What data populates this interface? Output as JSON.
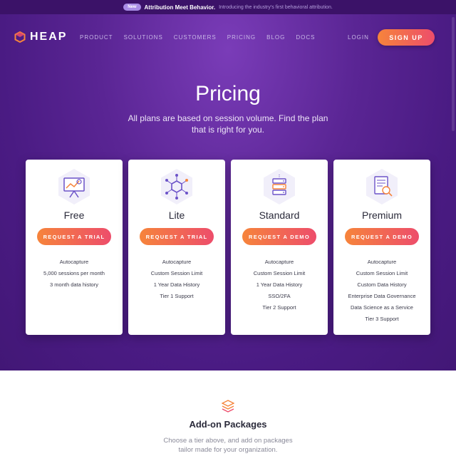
{
  "announcement": {
    "badge": "New",
    "headline": "Attribution Meet Behavior.",
    "sub": "Introducing the industry's first behavioral attribution."
  },
  "nav": {
    "logo_text": "HEAP",
    "links": [
      "PRODUCT",
      "SOLUTIONS",
      "CUSTOMERS",
      "PRICING",
      "BLOG",
      "DOCS"
    ],
    "login": "LOGIN",
    "signup": "SIGN UP"
  },
  "hero": {
    "title": "Pricing",
    "subtitle": "All plans are based on session volume. Find the plan that is right for you."
  },
  "plans": [
    {
      "name": "Free",
      "cta": "REQUEST A TRIAL",
      "icon": "presentation-chart-icon",
      "features": [
        "Autocapture",
        "5,000 sessions per month",
        "3 month data history"
      ]
    },
    {
      "name": "Lite",
      "cta": "REQUEST A TRIAL",
      "icon": "network-hexagon-icon",
      "features": [
        "Autocapture",
        "Custom Session Limit",
        "1 Year Data History",
        "Tier 1 Support"
      ]
    },
    {
      "name": "Standard",
      "cta": "REQUEST A DEMO",
      "icon": "server-stack-icon",
      "features": [
        "Autocapture",
        "Custom Session Limit",
        "1 Year Data History",
        "SSO/2FA",
        "Tier 2 Support"
      ]
    },
    {
      "name": "Premium",
      "cta": "REQUEST A DEMO",
      "icon": "document-search-icon",
      "features": [
        "Autocapture",
        "Custom Session Limit",
        "Custom Data History",
        "Enterprise Data Governance",
        "Data Science as a Service",
        "Tier 3 Support"
      ]
    }
  ],
  "addons": {
    "title": "Add-on Packages",
    "subtitle": "Choose a tier above, and add on packages tailor made for your organization."
  },
  "colors": {
    "hero_purple": "#4a1b83",
    "accent_orange": "#f6843b",
    "accent_pink": "#ed4d6b",
    "icon_purple": "#6b52c8"
  }
}
